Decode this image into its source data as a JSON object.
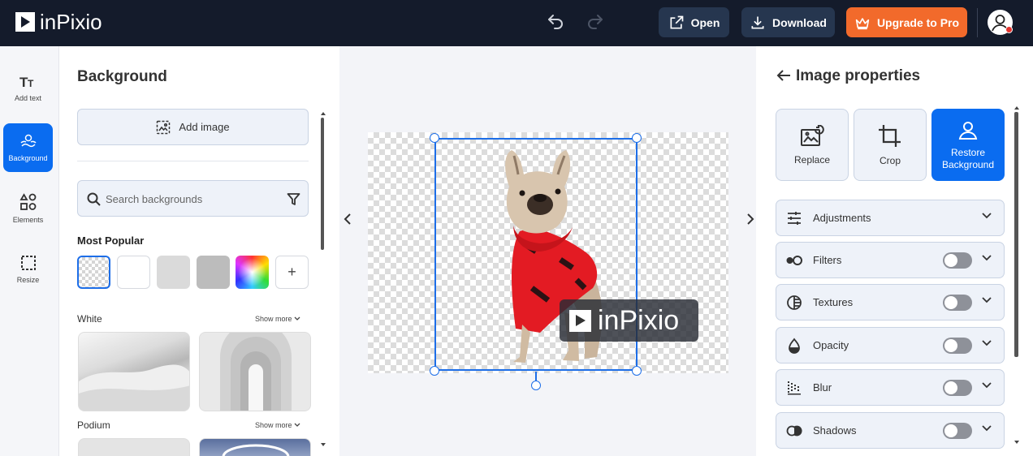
{
  "app": {
    "logo_text": "inPixio",
    "open_label": "Open",
    "download_label": "Download",
    "upgrade_label": "Upgrade to Pro"
  },
  "rail": {
    "items": [
      {
        "label": "Add text",
        "icon": "text-icon"
      },
      {
        "label": "Background",
        "icon": "background-icon",
        "active": true
      },
      {
        "label": "Elements",
        "icon": "elements-icon"
      },
      {
        "label": "Resize",
        "icon": "resize-icon"
      }
    ]
  },
  "left_panel": {
    "title": "Background",
    "add_image_label": "Add image",
    "search_placeholder": "Search backgrounds",
    "most_popular_label": "Most Popular",
    "swatches": [
      "transparent",
      "#ffffff",
      "#dadada",
      "#bcbcbc",
      "rainbow",
      "add"
    ],
    "add_swatch_symbol": "+",
    "sections": [
      {
        "label": "White",
        "show_more": "Show more"
      },
      {
        "label": "Podium",
        "show_more": "Show more"
      }
    ]
  },
  "canvas": {
    "watermark_text": "inPixio"
  },
  "right_panel": {
    "title": "Image properties",
    "tools": [
      {
        "label": "Replace",
        "icon": "replace-image-icon"
      },
      {
        "label": "Crop",
        "icon": "crop-icon"
      },
      {
        "label": "Restore Background",
        "icon": "person-icon",
        "active": true
      }
    ],
    "properties": [
      {
        "label": "Adjustments",
        "icon": "sliders-icon",
        "toggle": null
      },
      {
        "label": "Filters",
        "icon": "filters-icon",
        "toggle": false
      },
      {
        "label": "Textures",
        "icon": "textures-icon",
        "toggle": false
      },
      {
        "label": "Opacity",
        "icon": "drop-icon",
        "toggle": false
      },
      {
        "label": "Blur",
        "icon": "blur-icon",
        "toggle": false
      },
      {
        "label": "Shadows",
        "icon": "shadows-icon",
        "toggle": false
      }
    ]
  },
  "colors": {
    "topbar": "#141b2b",
    "accent": "#0a6cf0",
    "upgrade": "#f26a2b"
  }
}
